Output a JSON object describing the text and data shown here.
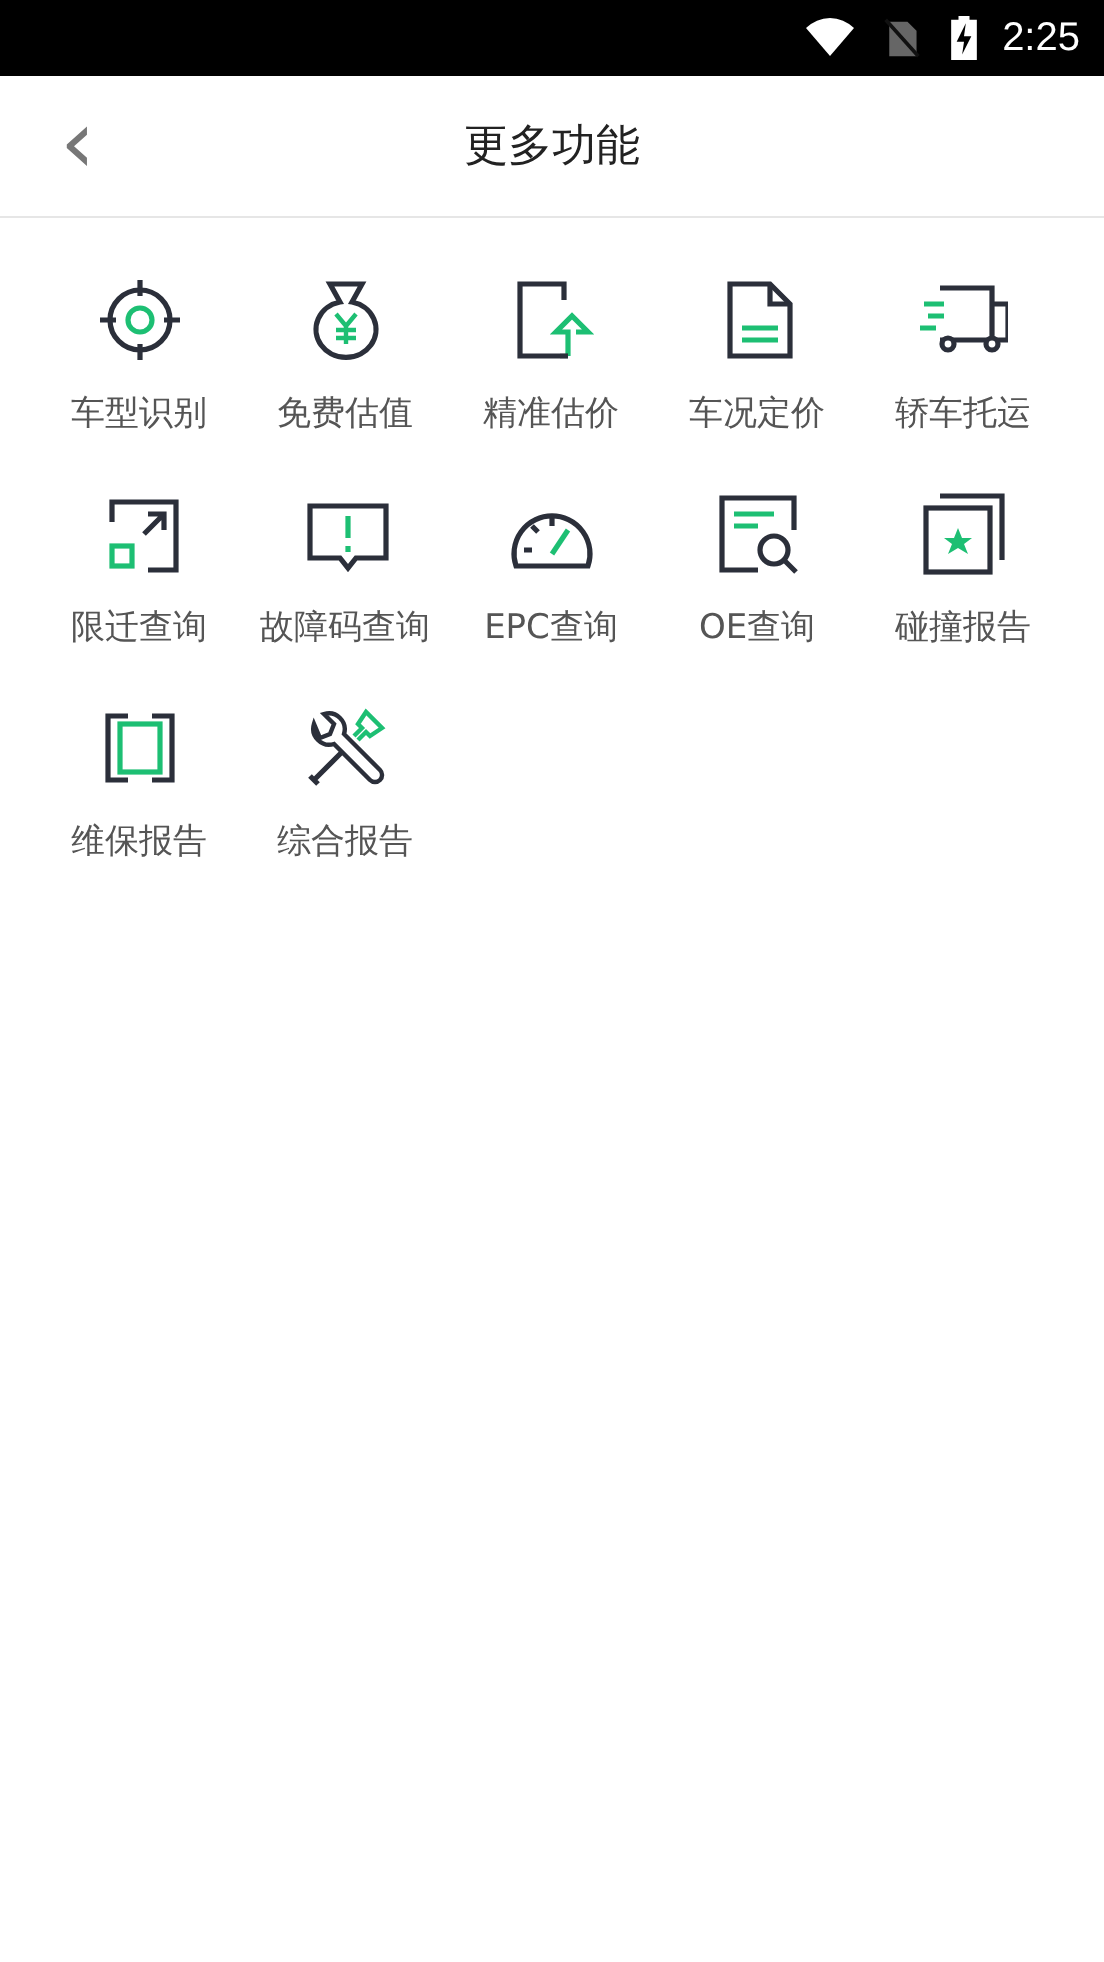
{
  "status_bar": {
    "time": "2:25"
  },
  "header": {
    "back": "‹",
    "title": "更多功能"
  },
  "features": [
    {
      "label": "车型识别"
    },
    {
      "label": "免费估值"
    },
    {
      "label": "精准估价"
    },
    {
      "label": "车况定价"
    },
    {
      "label": "轿车托运"
    },
    {
      "label": "限迁查询"
    },
    {
      "label": "故障码查询"
    },
    {
      "label": "EPC查询"
    },
    {
      "label": "OE查询"
    },
    {
      "label": "碰撞报告"
    },
    {
      "label": "维保报告"
    },
    {
      "label": "综合报告"
    }
  ]
}
